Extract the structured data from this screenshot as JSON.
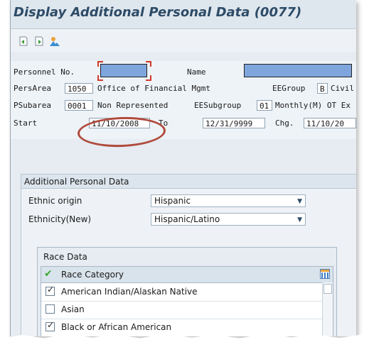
{
  "window": {
    "title": "Display Additional Personal Data (0077)"
  },
  "toolbar": {
    "icons": [
      "previous-record-icon",
      "next-record-icon",
      "overview-icon"
    ]
  },
  "header": {
    "personnel_label": "Personnel No.",
    "name_label": "Name",
    "persarea_label": "PersArea",
    "persarea_code": "1050",
    "persarea_text": "Office of Financial Mgmt",
    "eegroup_label": "EEGroup",
    "eegroup_code": "B",
    "eegroup_text": "Civil S",
    "psubarea_label": "PSubarea",
    "psubarea_code": "0001",
    "psubarea_text": "Non Represented",
    "eesubgroup_label": "EESubgroup",
    "eesubgroup_code": "01",
    "eesubgroup_text": "Monthly(M) OT Ex",
    "start_label": "Start",
    "start_value": "11/10/2008",
    "to_label": "To",
    "to_value": "12/31/9999",
    "chg_label": "Chg.",
    "chg_value": "11/10/20"
  },
  "additional": {
    "title": "Additional Personal Data",
    "ethnic_origin_label": "Ethnic origin",
    "ethnic_origin_value": "Hispanic",
    "ethnicity_new_label": "Ethnicity(New)",
    "ethnicity_new_value": "Hispanic/Latino"
  },
  "race": {
    "title": "Race Data",
    "column_header": "Race Category",
    "rows": [
      {
        "label": "American Indian/Alaskan Native",
        "checked": true
      },
      {
        "label": "Asian",
        "checked": false
      },
      {
        "label": "Black or African American",
        "checked": true
      }
    ]
  },
  "colors": {
    "title_text": "#2d4b67",
    "blank_field": "#7ea6dd",
    "highlight_oval": "#b04a3c",
    "checkmark_header": "#3aa832"
  }
}
